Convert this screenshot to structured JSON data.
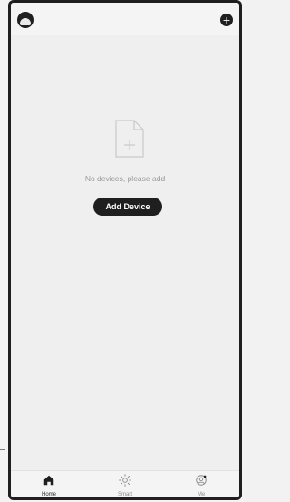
{
  "empty_state": {
    "message": "No devices, please add",
    "button_label": "Add Device"
  },
  "tabs": [
    {
      "label": "Home",
      "icon": "home-icon",
      "active": true
    },
    {
      "label": "Smart",
      "icon": "sun-icon",
      "active": false
    },
    {
      "label": "Me",
      "icon": "user-icon",
      "active": false
    }
  ],
  "colors": {
    "accent_dark": "#1f1f1f",
    "background": "#efefef",
    "muted_text": "#9a9a9a"
  }
}
